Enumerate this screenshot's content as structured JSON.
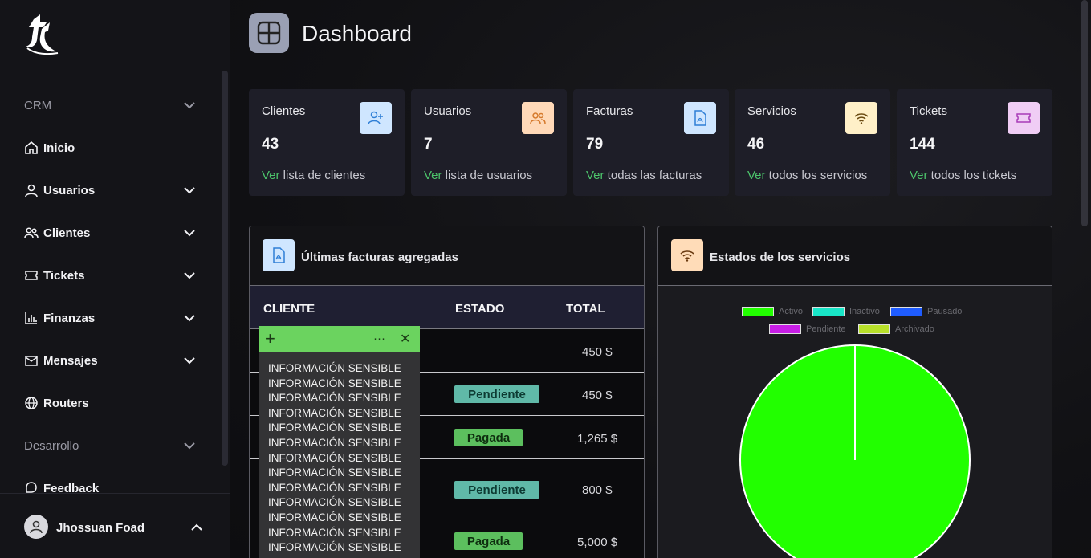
{
  "sidebar": {
    "items": [
      {
        "label": "CRM",
        "icon": "chevron-down-icon"
      },
      {
        "label": "Inicio",
        "icon": "home-icon"
      },
      {
        "label": "Usuarios",
        "icon": "user-icon"
      },
      {
        "label": "Clientes",
        "icon": "users-icon"
      },
      {
        "label": "Tickets",
        "icon": "ticket-icon"
      },
      {
        "label": "Finanzas",
        "icon": "bar-chart-icon"
      },
      {
        "label": "Mensajes",
        "icon": "mail-icon"
      },
      {
        "label": "Routers",
        "icon": "globe-icon"
      },
      {
        "label": "Desarrollo",
        "icon": "chevron-down-icon"
      },
      {
        "label": "Feedback",
        "icon": "feedback-icon"
      }
    ],
    "user_name": "Jhossuan Foad"
  },
  "header": {
    "title": "Dashboard"
  },
  "stats": [
    {
      "title": "Clientes",
      "value": "43",
      "link_ver": "Ver",
      "link_rest": " lista de clientes",
      "icon": "user-plus-icon",
      "color": "#cfe6ff"
    },
    {
      "title": "Usuarios",
      "value": "7",
      "link_ver": "Ver",
      "link_rest": " lista de usuarios",
      "icon": "users-icon",
      "color": "#ffd9b8"
    },
    {
      "title": "Facturas",
      "value": "79",
      "link_ver": "Ver",
      "link_rest": " todas las facturas",
      "icon": "pdf-file-icon",
      "color": "#cfe6ff"
    },
    {
      "title": "Servicios",
      "value": "46",
      "link_ver": "Ver",
      "link_rest": " todos los servicios",
      "icon": "wifi-icon",
      "color": "#fff0c8"
    },
    {
      "title": "Tickets",
      "value": "144",
      "link_ver": "Ver",
      "link_rest": " todos los tickets",
      "icon": "ticket-icon",
      "color": "#f0cdf5"
    }
  ],
  "invoices": {
    "title": "Últimas facturas agregadas",
    "columns": [
      "CLIENTE",
      "ESTADO",
      "TOTAL"
    ],
    "rows": [
      {
        "estado": "",
        "total": "450 $"
      },
      {
        "estado": "Pendiente",
        "total": "450 $"
      },
      {
        "estado": "Pagada",
        "total": "1,265 $"
      },
      {
        "estado": "Pendiente",
        "total": "800 $"
      },
      {
        "estado": "Pagada",
        "total": "5,000 $"
      }
    ]
  },
  "overlay": {
    "lines": [
      "INFORMACIÓN SENSIBLE",
      "INFORMACIÓN SENSIBLE",
      "INFORMACIÓN SENSIBLE",
      "INFORMACIÓN SENSIBLE",
      "INFORMACIÓN SENSIBLE",
      "INFORMACIÓN SENSIBLE",
      "INFORMACIÓN SENSIBLE",
      "INFORMACIÓN SENSIBLE",
      "INFORMACIÓN SENSIBLE",
      "INFORMACIÓN SENSIBLE",
      "INFORMACIÓN SENSIBLE",
      "INFORMACIÓN SENSIBLE",
      "INFORMACIÓN SENSIBLE"
    ],
    "add_label": "+",
    "more_label": "···",
    "close_label": "✕"
  },
  "services": {
    "title": "Estados de los servicios"
  },
  "chart_data": {
    "type": "pie",
    "categories": [
      "Activo",
      "Inactivo",
      "Pausado",
      "Pendiente",
      "Archivado"
    ],
    "values": [
      46,
      0,
      0,
      0,
      0
    ],
    "colors": [
      "#22ff00",
      "#19e6c8",
      "#1f5cff",
      "#c81ee6",
      "#b8e02a"
    ],
    "legend_position": "top"
  }
}
